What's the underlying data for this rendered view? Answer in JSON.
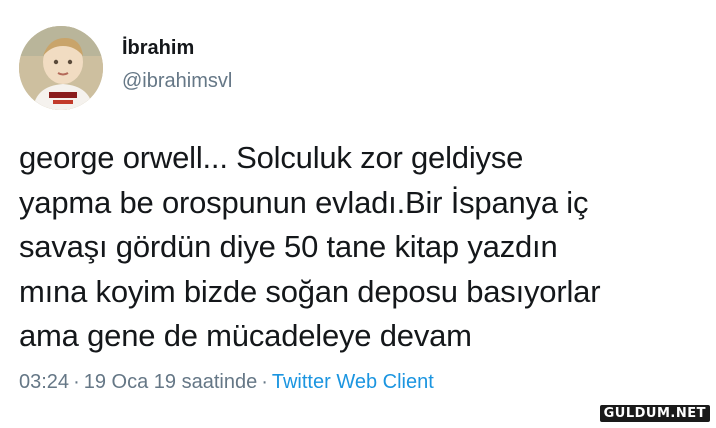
{
  "user": {
    "display_name": "İbrahim",
    "handle": "@ibrahimsvl",
    "avatar_icon": "child-profile-photo"
  },
  "tweet": {
    "lines": [
      "george orwell... Solculuk zor geldiyse",
      "yapma be orospunun evladı.Bir İspanya iç",
      "savaşı gördün diye 50 tane kitap yazdın",
      "mına koyim bizde soğan deposu basıyorlar",
      "ama gene de mücadeleye devam"
    ],
    "time": "03:24",
    "separator": "·",
    "date": "19 Oca 19 saatinde",
    "client": "Twitter Web Client"
  },
  "watermark": "GULDUM.NET",
  "colors": {
    "text": "#14171a",
    "muted": "#657786",
    "link": "#1b95e0"
  }
}
